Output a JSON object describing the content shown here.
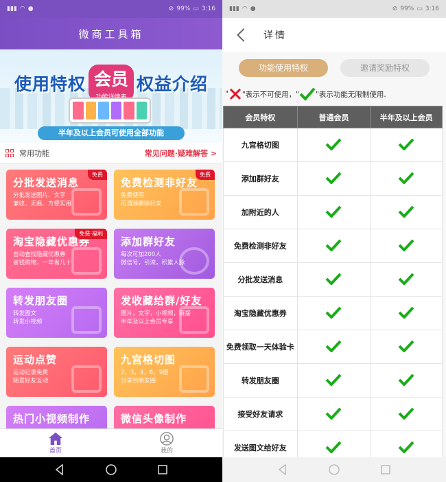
{
  "left": {
    "status": {
      "signal": "\"all",
      "battery": "99%",
      "time": "3:16"
    },
    "app_title": "微商工具箱",
    "banner": {
      "title_part1": "使用特权",
      "title_highlight": "会员",
      "title_part2": "权益介绍",
      "subtitle": "功能详情表",
      "footer": "半年及以上会员可使用全部功能"
    },
    "section": {
      "label": "常用功能",
      "faq_link": "常见问题·疑难解答 >"
    },
    "cards": [
      {
        "title": "分批发送消息",
        "desc": "分批发送图片、文字\n兼收、无痕、方便实用",
        "badge": "免费"
      },
      {
        "title": "免费检测非好友",
        "desc": "免费使用\n可清除删除好友",
        "badge": "免费"
      },
      {
        "title": "淘宝隐藏优惠券",
        "desc": "自动查找隐藏优惠券\n省钱购物，一年省几十",
        "badge": "免费·福利"
      },
      {
        "title": "添加群好友",
        "desc": "每次可加200人\n微信号，引流，积累人脉",
        "badge": ""
      },
      {
        "title": "转发朋友圈",
        "desc": "转发图文\n转发小视频",
        "badge": ""
      },
      {
        "title": "发收藏给群/好友",
        "desc": "图片，文字，小视频，链接\n半年及以上会员专享",
        "badge": ""
      },
      {
        "title": "运动点赞",
        "desc": "运动记录免费\n随意好友互动",
        "badge": ""
      },
      {
        "title": "九宫格切图",
        "desc": "2，3，4，6，9图\n分享到朋友圈",
        "badge": ""
      },
      {
        "title": "热门小视频制作",
        "desc": "",
        "badge": ""
      },
      {
        "title": "微信头像制作",
        "desc": "",
        "badge": ""
      }
    ],
    "tabs": [
      {
        "label": "首页",
        "icon": "home-icon"
      },
      {
        "label": "我的",
        "icon": "profile-icon"
      }
    ]
  },
  "right": {
    "status": {
      "battery": "99%",
      "time": "3:16"
    },
    "page_title": "详情",
    "tabs": [
      {
        "label": "功能使用特权"
      },
      {
        "label": "邀请奖励特权"
      }
    ],
    "legend": {
      "open_quote": "\"",
      "cross_text": "\"表示不可使用，\"",
      "check_text": "\"表示功能无限制使用."
    },
    "table": {
      "headers": [
        "会员特权",
        "普通会员",
        "半年及以上会员"
      ],
      "rows": [
        "九宫格切图",
        "添加群好友",
        "加附近的人",
        "免费检测非好友",
        "分批发送消息",
        "淘宝隐藏优惠券",
        "免费领取一天体验卡",
        "转发朋友圈",
        "接受好友请求",
        "发送图文给好友"
      ]
    },
    "colors": {
      "accent": "#d9b07a",
      "check": "#1aad19",
      "cross": "#e0162b"
    }
  }
}
